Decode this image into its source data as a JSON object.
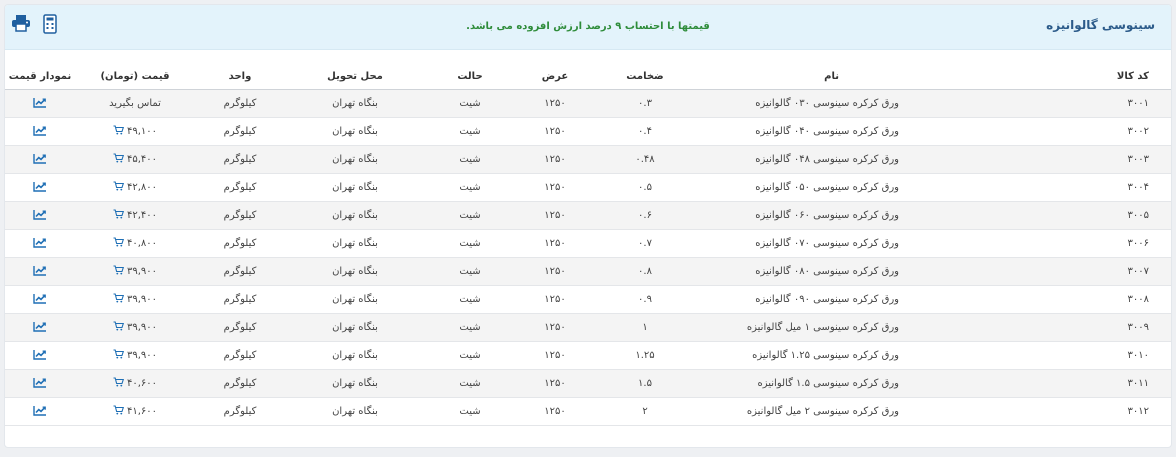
{
  "header": {
    "title": "سینوسی گالوانیزه",
    "note": "قیمتها با احتساب ۹ درصد ارزش افزوده می باشد.",
    "print_icon": "printer-icon",
    "calc_icon": "calculator-icon"
  },
  "colors": {
    "header_bg": "#e3f3fb",
    "title": "#2c5b8a",
    "note": "#2e8c3a",
    "link": "#1f6fb5"
  },
  "table": {
    "columns": [
      "کد کالا",
      "نام",
      "ضخامت",
      "عرض",
      "حالت",
      "محل تحویل",
      "واحد",
      "قیمت (تومان)",
      "نمودار قیمت"
    ],
    "rows": [
      {
        "code": "۳۰۰۱",
        "name": "ورق کرکره سینوسی ۰۳۰ گالوانیزه",
        "thickness": "۰.۳",
        "width": "۱۲۵۰",
        "state": "شیت",
        "delivery": "بنگاه تهران",
        "unit": "کیلوگرم",
        "price": "تماس بگیرید",
        "cart": false
      },
      {
        "code": "۳۰۰۲",
        "name": "ورق کرکره سینوسی ۰۴۰ گالوانیزه",
        "thickness": "۰.۴",
        "width": "۱۲۵۰",
        "state": "شیت",
        "delivery": "بنگاه تهران",
        "unit": "کیلوگرم",
        "price": "۴۹,۱۰۰",
        "cart": true
      },
      {
        "code": "۳۰۰۳",
        "name": "ورق کرکره سینوسی ۰۴۸ گالوانیزه",
        "thickness": "۰.۴۸",
        "width": "۱۲۵۰",
        "state": "شیت",
        "delivery": "بنگاه تهران",
        "unit": "کیلوگرم",
        "price": "۴۵,۴۰۰",
        "cart": true
      },
      {
        "code": "۳۰۰۴",
        "name": "ورق کرکره سینوسی ۰۵۰ گالوانیزه",
        "thickness": "۰.۵",
        "width": "۱۲۵۰",
        "state": "شیت",
        "delivery": "بنگاه تهران",
        "unit": "کیلوگرم",
        "price": "۴۲,۸۰۰",
        "cart": true
      },
      {
        "code": "۳۰۰۵",
        "name": "ورق کرکره سینوسی ۰۶۰ گالوانیزه",
        "thickness": "۰.۶",
        "width": "۱۲۵۰",
        "state": "شیت",
        "delivery": "بنگاه تهران",
        "unit": "کیلوگرم",
        "price": "۴۲,۴۰۰",
        "cart": true
      },
      {
        "code": "۳۰۰۶",
        "name": "ورق کرکره سینوسی ۰۷۰ گالوانیزه",
        "thickness": "۰.۷",
        "width": "۱۲۵۰",
        "state": "شیت",
        "delivery": "بنگاه تهران",
        "unit": "کیلوگرم",
        "price": "۴۰,۸۰۰",
        "cart": true
      },
      {
        "code": "۳۰۰۷",
        "name": "ورق کرکره سینوسی ۰۸۰ گالوانیزه",
        "thickness": "۰.۸",
        "width": "۱۲۵۰",
        "state": "شیت",
        "delivery": "بنگاه تهران",
        "unit": "کیلوگرم",
        "price": "۳۹,۹۰۰",
        "cart": true
      },
      {
        "code": "۳۰۰۸",
        "name": "ورق کرکره سینوسی ۰۹۰ گالوانیزه",
        "thickness": "۰.۹",
        "width": "۱۲۵۰",
        "state": "شیت",
        "delivery": "بنگاه تهران",
        "unit": "کیلوگرم",
        "price": "۳۹,۹۰۰",
        "cart": true
      },
      {
        "code": "۳۰۰۹",
        "name": "ورق کرکره سینوسی ۱ میل گالوانیزه",
        "thickness": "۱",
        "width": "۱۲۵۰",
        "state": "شیت",
        "delivery": "بنگاه تهران",
        "unit": "کیلوگرم",
        "price": "۳۹,۹۰۰",
        "cart": true
      },
      {
        "code": "۳۰۱۰",
        "name": "ورق کرکره سینوسی ۱.۲۵ گالوانیزه",
        "thickness": "۱.۲۵",
        "width": "۱۲۵۰",
        "state": "شیت",
        "delivery": "بنگاه تهران",
        "unit": "کیلوگرم",
        "price": "۳۹,۹۰۰",
        "cart": true
      },
      {
        "code": "۳۰۱۱",
        "name": "ورق کرکره سینوسی ۱.۵ گالوانیزه",
        "thickness": "۱.۵",
        "width": "۱۲۵۰",
        "state": "شیت",
        "delivery": "بنگاه تهران",
        "unit": "کیلوگرم",
        "price": "۴۰,۶۰۰",
        "cart": true
      },
      {
        "code": "۳۰۱۲",
        "name": "ورق کرکره سینوسی ۲ میل گالوانیزه",
        "thickness": "۲",
        "width": "۱۲۵۰",
        "state": "شیت",
        "delivery": "بنگاه تهران",
        "unit": "کیلوگرم",
        "price": "۴۱,۶۰۰",
        "cart": true
      }
    ]
  }
}
